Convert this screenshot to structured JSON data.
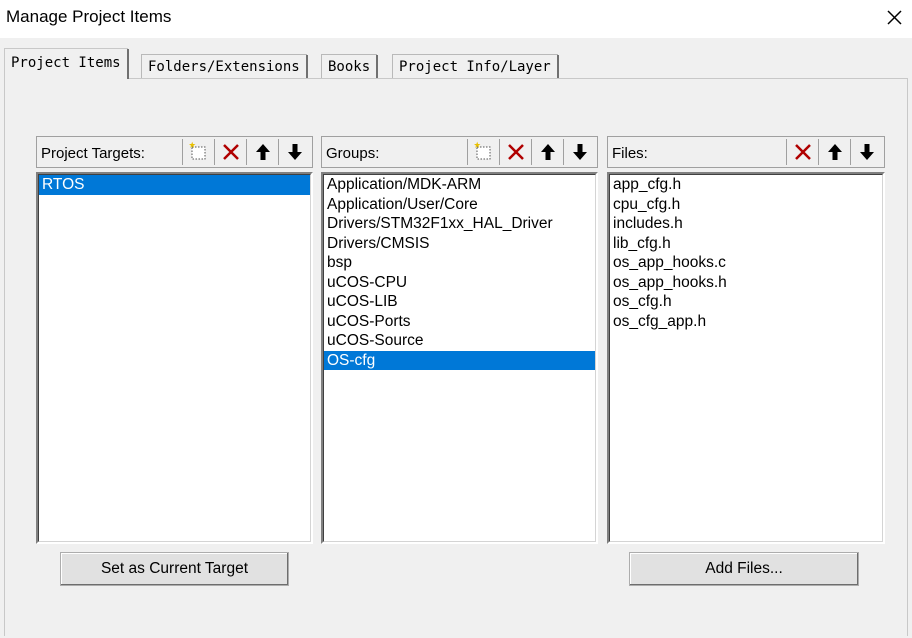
{
  "window": {
    "title": "Manage Project Items"
  },
  "tabs": [
    {
      "label": "Project Items",
      "active": true
    },
    {
      "label": "Folders/Extensions",
      "active": false
    },
    {
      "label": "Books",
      "active": false
    },
    {
      "label": "Project Info/Layer",
      "active": false
    }
  ],
  "targets": {
    "label": "Project Targets:",
    "items": [
      "RTOS"
    ],
    "selected_index": 0
  },
  "groups": {
    "label": "Groups:",
    "items": [
      "Application/MDK-ARM",
      "Application/User/Core",
      "Drivers/STM32F1xx_HAL_Driver",
      "Drivers/CMSIS",
      "bsp",
      "uCOS-CPU",
      "uCOS-LIB",
      "uCOS-Ports",
      "uCOS-Source",
      "OS-cfg"
    ],
    "selected_index": 9
  },
  "files": {
    "label": "Files:",
    "items": [
      "app_cfg.h",
      "cpu_cfg.h",
      "includes.h",
      "lib_cfg.h",
      "os_app_hooks.c",
      "os_app_hooks.h",
      "os_cfg.h",
      "os_cfg_app.h"
    ]
  },
  "buttons": {
    "set_current_target": "Set as Current Target",
    "add_files": "Add Files..."
  },
  "colors": {
    "selection": "#0078d7",
    "delete_icon": "#b00000"
  }
}
